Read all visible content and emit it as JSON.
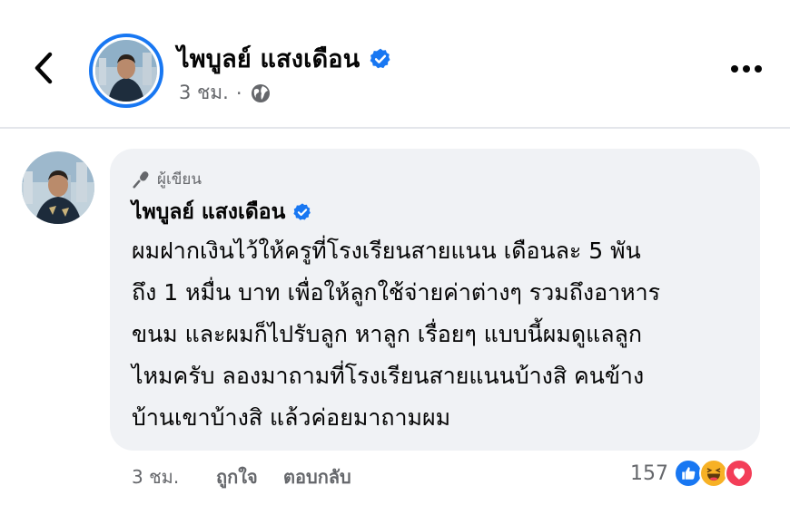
{
  "header": {
    "author_name": "ไพบูลย์ แสงเดือน",
    "post_time": "3 ชม.",
    "separator": "·",
    "back_icon": "chevron-left-icon",
    "more_icon": "more-dots-icon",
    "privacy_icon": "globe-icon"
  },
  "comment": {
    "badge_label": "ผู้เขียน",
    "author_name": "ไพบูลย์ แสงเดือน",
    "text_lines": [
      "ผมฝากเงินไว้ให้ครูที่โรงเรียนสายแนน เดือนละ 5 พัน",
      "ถึง 1 หมื่น บาท เพื่อให้ลูกใช้จ่ายค่าต่างๆ รวมถึงอาหาร",
      "ขนม และผมก็ไปรับลูก หาลูก เรื่อยๆ แบบนี้ผมดูแลลูก",
      "ไหมครับ ลองมาถามที่โรงเรียนสายแนนบ้างสิ คนข้าง",
      "บ้านเขาบ้างสิ แล้วค่อยมาถามผม"
    ],
    "time": "3 ชม.",
    "like_label": "ถูกใจ",
    "reply_label": "ตอบกลับ",
    "reaction_count": "157",
    "reactions": [
      "like",
      "haha",
      "love"
    ]
  },
  "colors": {
    "accent": "#1877f2",
    "bubble": "#f0f2f5",
    "secondary_text": "#65676b",
    "love": "#f33e58",
    "haha": "#f7b125"
  }
}
